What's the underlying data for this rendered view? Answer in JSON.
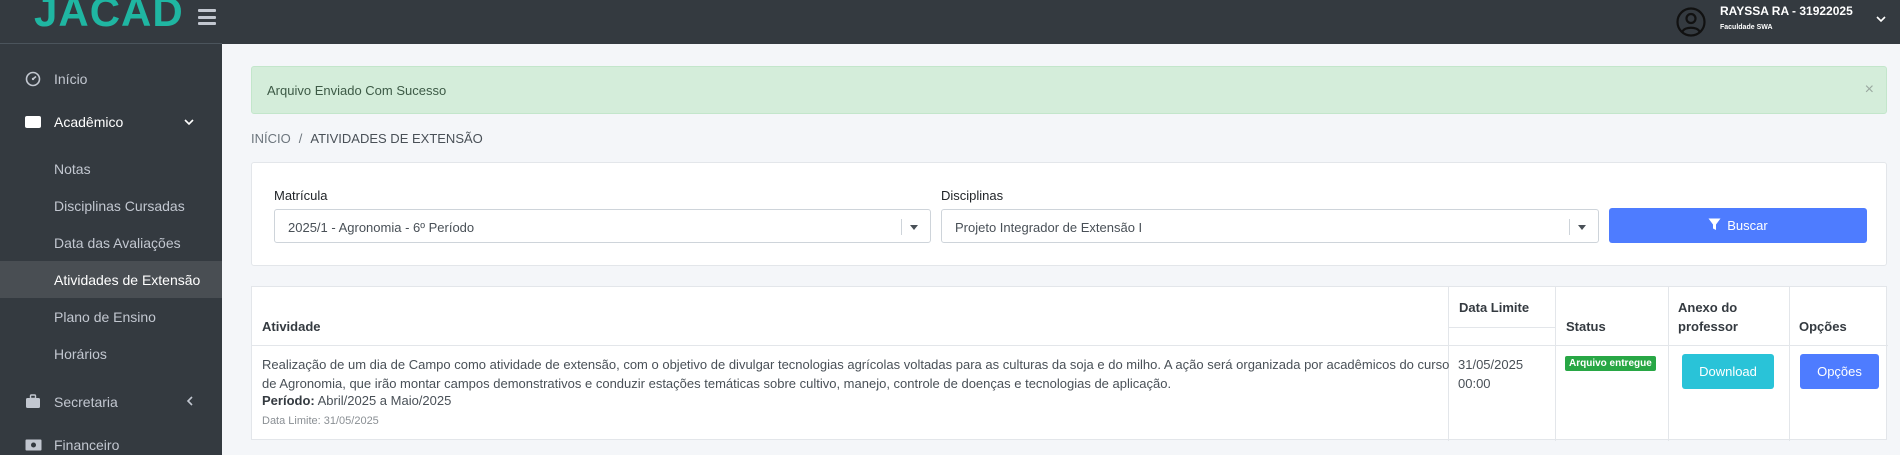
{
  "brand": {
    "logo_text": "JACAD"
  },
  "user": {
    "name": "RAYSSA RA - 31922025",
    "institution": "Faculdade SWA"
  },
  "sidebar": {
    "items": [
      {
        "label": "Início",
        "icon": "dashboard-icon"
      },
      {
        "label": "Acadêmico",
        "icon": "book-icon",
        "expanded": true
      },
      {
        "label": "Secretaria",
        "icon": "briefcase-icon"
      },
      {
        "label": "Financeiro",
        "icon": "money-icon"
      }
    ],
    "academico_sub": [
      {
        "label": "Notas"
      },
      {
        "label": "Disciplinas Cursadas"
      },
      {
        "label": "Data das Avaliações"
      },
      {
        "label": "Atividades de Extensão",
        "active": true
      },
      {
        "label": "Plano de Ensino"
      },
      {
        "label": "Horários"
      }
    ]
  },
  "alert": {
    "text": "Arquivo Enviado Com Sucesso",
    "close": "×"
  },
  "breadcrumb": {
    "home": "INÍCIO",
    "separator": "/",
    "current": "ATIVIDADES DE EXTENSÃO"
  },
  "filters": {
    "matricula_label": "Matrícula",
    "matricula_value": "2025/1 - Agronomia - 6º Período",
    "disciplinas_label": "Disciplinas",
    "disciplinas_value": "Projeto Integrador de Extensão I",
    "search_label": "Buscar"
  },
  "table": {
    "headers": {
      "atividade": "Atividade",
      "data_limite": "Data Limite",
      "status": "Status",
      "anexo_1": "Anexo do",
      "anexo_2": "professor",
      "opcoes": "Opções"
    },
    "row": {
      "description": "Realização de um dia de Campo como atividade de extensão, com o objetivo de divulgar tecnologias agrícolas voltadas para as culturas da soja e do milho. A ação será organizada por acadêmicos do curso de Agronomia, que irão montar campos demonstrativos e conduzir estações temáticas sobre cultivo, manejo, controle de doenças e tecnologias de aplicação.",
      "periodo_label": "Período:",
      "periodo_value": "Abril/2025 a Maio/2025",
      "data_limite_small": "Data Limite: 31/05/2025",
      "date": "31/05/2025",
      "time": "00:00",
      "status": "Arquivo entregue",
      "download_label": "Download",
      "opcoes_label": "Opções"
    }
  },
  "colors": {
    "sidebar_bg": "#343a40",
    "accent": "#4e7cff",
    "success": "#28a745",
    "info": "#29c3d8",
    "logo": "#1fb6a2"
  }
}
